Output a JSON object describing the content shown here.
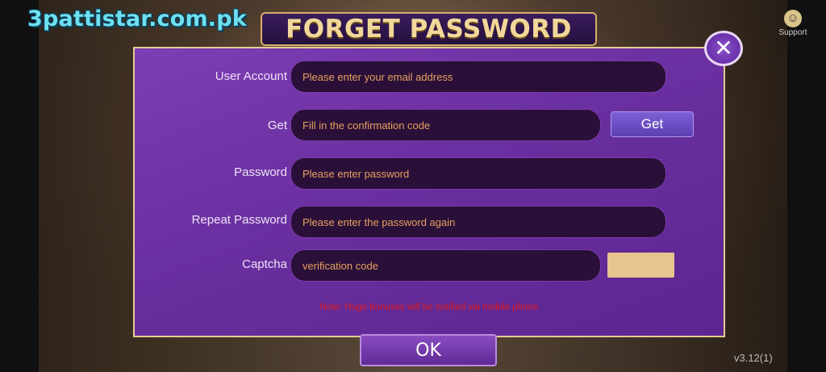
{
  "watermark": "3pattistar.com.pk",
  "title": "FORGET PASSWORD",
  "support_label": "Support",
  "close_glyph": "✕",
  "form": {
    "user_account": {
      "label": "User Account",
      "placeholder": "Please enter your email address"
    },
    "get_code": {
      "label": "Get",
      "placeholder": "Fill in the confirmation code",
      "button": "Get"
    },
    "password": {
      "label": "Password",
      "placeholder": "Please enter password"
    },
    "repeat_password": {
      "label": "Repeat Password",
      "placeholder": "Please enter the password again"
    },
    "captcha": {
      "label": "Captcha",
      "placeholder": "verification code"
    }
  },
  "note": "Note: Huge bonuses will be notified via mobile phone",
  "ok_label": "OK",
  "version": "v3.12(1)",
  "colors": {
    "panel": "#6a2fa0",
    "border": "#e4cc94",
    "placeholder": "#e5a25f",
    "note": "#e01a1a"
  }
}
